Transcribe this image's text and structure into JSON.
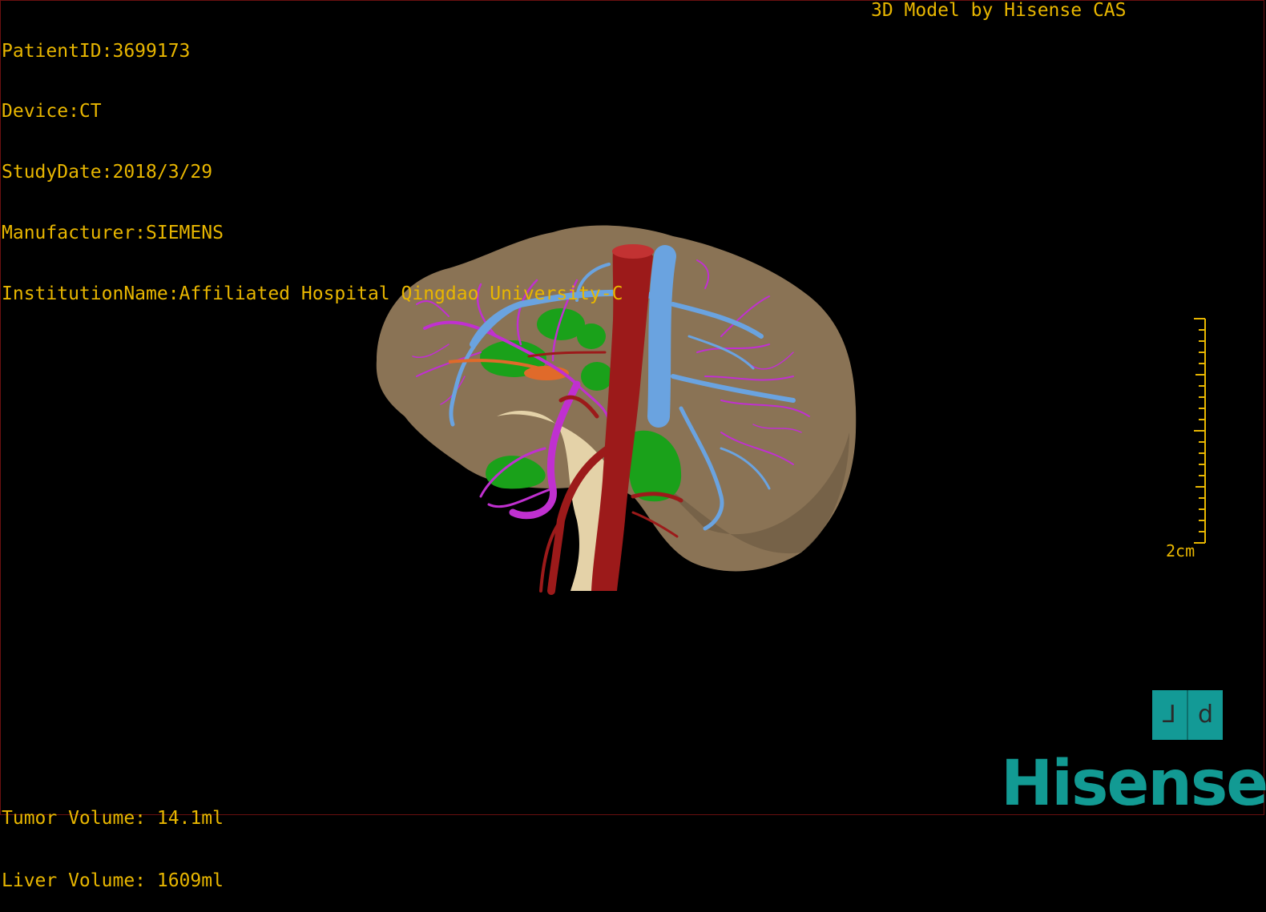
{
  "header": {
    "patient_id": "PatientID:3699173",
    "device": "Device:CT",
    "study_date": "StudyDate:2018/3/29",
    "manufacturer": "Manufacturer:SIEMENS",
    "institution": "InstitutionName:Affiliated Hospital Qingdao University-C",
    "model_credit": "3D Model by Hisense CAS"
  },
  "footer": {
    "tumor_volume": "Tumor Volume: 14.1ml",
    "liver_volume": "Liver Volume: 1609ml"
  },
  "scale_bar": {
    "label": "2cm"
  },
  "orientation_cube": {
    "left_glyph": "⅃",
    "right_glyph": "d"
  },
  "logo": {
    "text": "Hisense"
  },
  "colors": {
    "overlay_text": "#e8b600",
    "liver": "#8a7355",
    "aorta": "#9c1a1a",
    "portal_vein": "#6aa3e0",
    "hepatic_artery": "#c030d0",
    "tumor_green": "#1aa11a",
    "brand": "#129a93"
  }
}
